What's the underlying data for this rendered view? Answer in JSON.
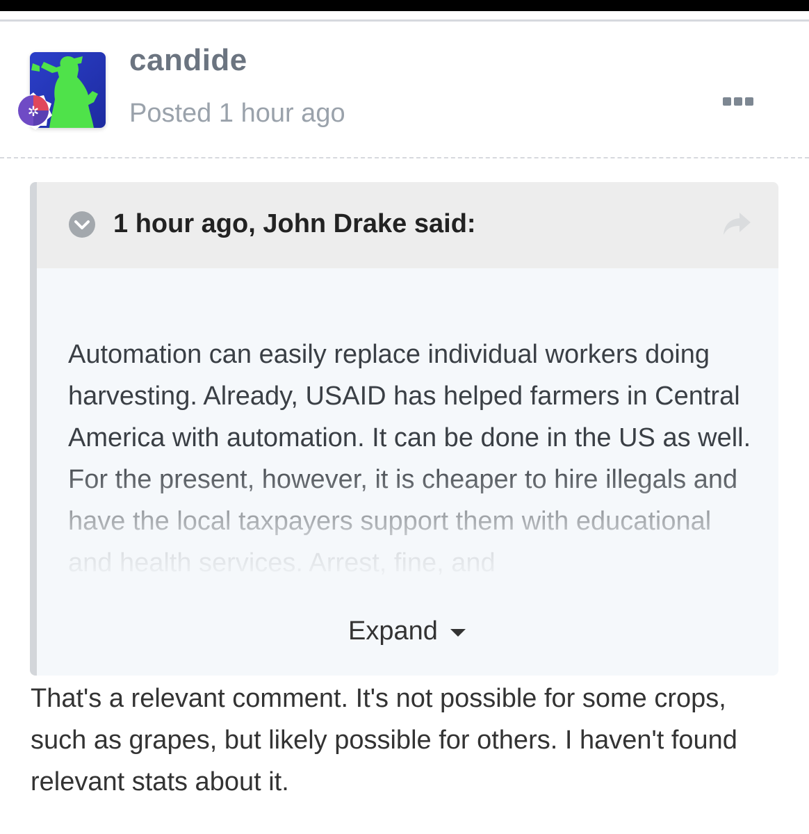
{
  "post": {
    "author": "candide",
    "posted_prefix": "Posted",
    "posted_time": "1 hour ago",
    "more_icon": "ellipsis-icon"
  },
  "quote": {
    "citation": "1 hour ago, John Drake said:",
    "text": "Automation can easily replace individual workers doing harvesting. Already, USAID has helped farmers in Central America with automation. It can be done in the US as well. For the present, however, it is cheaper to hire illegals and have the local taxpayers support them with educational and health services. Arrest, fine, and",
    "expand_label": "Expand",
    "collapse_icon": "chevron-circle-icon",
    "share_icon": "share-arrow-icon"
  },
  "reply": {
    "text": "That's a relevant comment. It's not possible for some crops, such as grapes, but likely possible for others. I haven't found relevant stats about it."
  },
  "colors": {
    "author": "#6b7480",
    "meta": "#9aa2ab",
    "quote_bg": "#f5f8fb",
    "quote_head_bg": "#ededed",
    "quote_border": "#d3d6da"
  }
}
